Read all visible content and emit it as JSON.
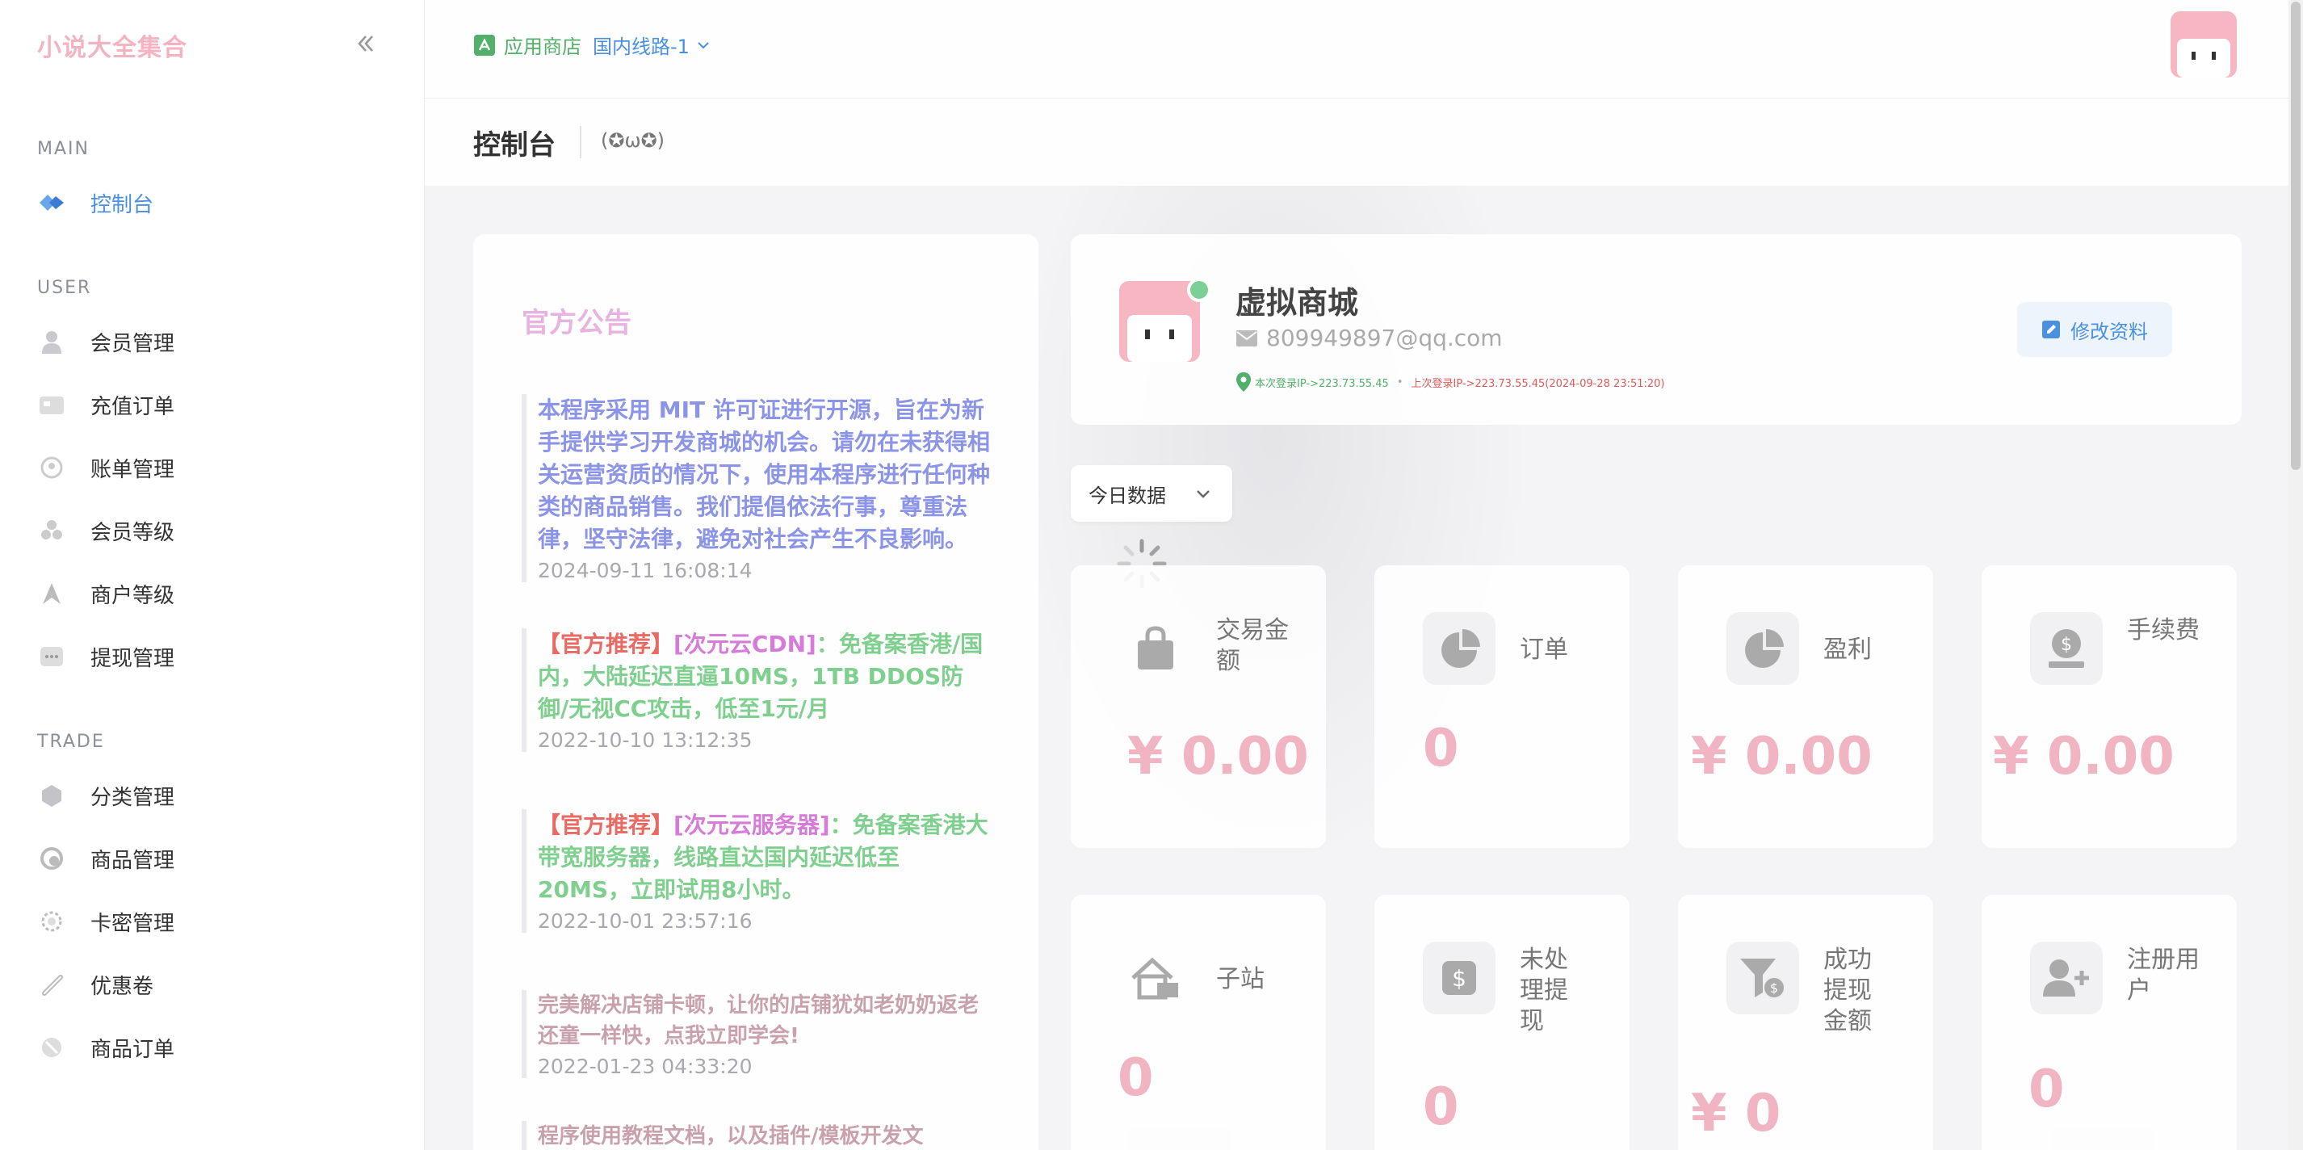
{
  "sidebar": {
    "brand": "小说大全集合",
    "sections": [
      {
        "title": "MAIN",
        "items": [
          {
            "label": "控制台",
            "icon": "dashboard-icon",
            "active": true
          }
        ]
      },
      {
        "title": "USER",
        "items": [
          {
            "label": "会员管理",
            "icon": "user-icon"
          },
          {
            "label": "充值订单",
            "icon": "recharge-icon"
          },
          {
            "label": "账单管理",
            "icon": "bill-icon"
          },
          {
            "label": "会员等级",
            "icon": "member-level-icon"
          },
          {
            "label": "商户等级",
            "icon": "merchant-level-icon"
          },
          {
            "label": "提现管理",
            "icon": "withdraw-icon"
          }
        ]
      },
      {
        "title": "TRADE",
        "items": [
          {
            "label": "分类管理",
            "icon": "category-icon"
          },
          {
            "label": "商品管理",
            "icon": "product-icon"
          },
          {
            "label": "卡密管理",
            "icon": "card-key-icon"
          },
          {
            "label": "优惠卷",
            "icon": "coupon-icon"
          },
          {
            "label": "商品订单",
            "icon": "order-icon"
          }
        ]
      }
    ]
  },
  "topbar": {
    "store_label": "应用商店",
    "route_label": "国内线路-1"
  },
  "page": {
    "title": "控制台",
    "emoji": "(✪ω✪)"
  },
  "notice": {
    "title": "官方公告",
    "items": [
      {
        "text": "本程序采用 MIT 许可证进行开源，旨在为新手提供学习开发商城的机会。请勿在未获得相关运营资质的情况下，使用本程序进行任何种类的商品销售。我们提倡依法行事，尊重法律，坚守法律，避免对社会产生不良影响。",
        "time": "2024-09-11 16:08:14"
      },
      {
        "tag": "【官方推荐】",
        "link": "[次元云CDN]",
        "text": "：免备案香港/国内，大陆延迟直逼10MS，1TB DDOS防御/无视CC攻击，低至1元/月",
        "time": "2022-10-10 13:12:35"
      },
      {
        "tag": "【官方推荐】",
        "link": "[次元云服务器]",
        "text": "：免备案香港大带宽服务器，线路直达国内延迟低至20MS，立即试用8小时。",
        "time": "2022-10-01 23:57:16"
      },
      {
        "text": "完美解决店铺卡顿，让你的店铺犹如老奶奶返老还童一样快，点我立即学会!",
        "time": "2022-01-23 04:33:20"
      },
      {
        "text": "程序使用教程文档，以及插件/模板开发文"
      }
    ]
  },
  "profile": {
    "name": "虚拟商城",
    "email": "809949897@qq.com",
    "login_current": "本次登录IP->223.73.55.45",
    "login_separator": "•",
    "login_last": "上次登录IP->223.73.55.45(2024-09-28 23:51:20)",
    "edit_label": "修改资料"
  },
  "date_filter": {
    "selected": "今日数据"
  },
  "stats": [
    {
      "label": "交易金额",
      "value": "¥ 0.00",
      "icon": "shopping-bag-icon"
    },
    {
      "label": "订单",
      "value": "0",
      "icon": "pie-chart-icon"
    },
    {
      "label": "盈利",
      "value": "¥ 0.00",
      "icon": "pie-chart-icon"
    },
    {
      "label": "手续费",
      "value": "¥ 0.00",
      "icon": "fee-icon"
    },
    {
      "label": "子站",
      "value": "0",
      "icon": "house-icon"
    },
    {
      "label": "未处理提现",
      "value": "0",
      "icon": "dollar-icon"
    },
    {
      "label": "成功提现金额",
      "value": "¥ 0",
      "icon": "funnel-dollar-icon"
    },
    {
      "label": "注册用户",
      "value": "0",
      "icon": "add-user-icon"
    }
  ],
  "colors": {
    "brand": "#f4b3c0",
    "accent_blue": "#4a90e2",
    "stat_value": "#f0b4c2",
    "notice_title": "#e8b3de"
  }
}
